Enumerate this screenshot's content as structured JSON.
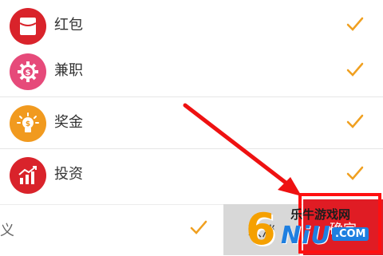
{
  "items": [
    {
      "label": "红包",
      "icon": "red-envelope-icon",
      "color": "#d9232b",
      "checked": true
    },
    {
      "label": "兼职",
      "icon": "dollar-gear-icon",
      "color": "#e64a7a",
      "checked": true
    },
    {
      "label": "奖金",
      "icon": "lightbulb-icon",
      "color": "#f19a1f",
      "checked": true
    },
    {
      "label": "投资",
      "icon": "growth-chart-icon",
      "color": "#d9232b",
      "checked": true
    }
  ],
  "bottom": {
    "partial_label": "义",
    "cancel_label": "取消",
    "confirm_label": "确定"
  },
  "watermark": {
    "number": "6",
    "site_name": "乐牛游戏网",
    "brand": "NiU",
    "domain": ".COM"
  },
  "colors": {
    "check": "#f0a020",
    "confirm": "#e01c24",
    "cancel": "#d8d8d8"
  }
}
